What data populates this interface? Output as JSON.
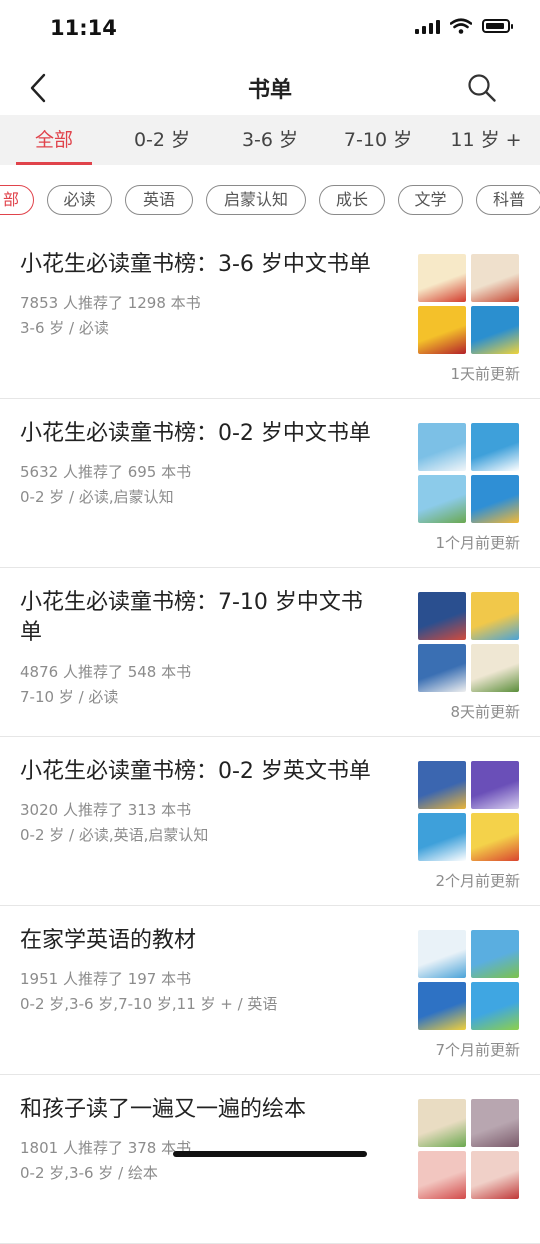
{
  "status_bar": {
    "time": "11:14",
    "icons": [
      "signal-icon",
      "wifi-icon",
      "battery-icon"
    ]
  },
  "header": {
    "title": "书单",
    "back_icon": "chevron-left-icon",
    "search_icon": "search-icon"
  },
  "age_tabs": [
    {
      "label": "全部",
      "active": true
    },
    {
      "label": "0-2 岁",
      "active": false
    },
    {
      "label": "3-6 岁",
      "active": false
    },
    {
      "label": "7-10 岁",
      "active": false
    },
    {
      "label": "11 岁 +",
      "active": false
    }
  ],
  "category_chips": [
    {
      "label": "部",
      "active": true
    },
    {
      "label": "必读",
      "active": false
    },
    {
      "label": "英语",
      "active": false
    },
    {
      "label": "启蒙认知",
      "active": false
    },
    {
      "label": "成长",
      "active": false
    },
    {
      "label": "文学",
      "active": false
    },
    {
      "label": "科普",
      "active": false
    }
  ],
  "colors": {
    "accent": "#e0434b",
    "muted_text": "#8c8c8c",
    "tab_bar_bg": "#f2f2f2"
  },
  "booklists": [
    {
      "title": "小花生必读童书榜：3-6 岁中文书单",
      "stats": "7853 人推荐了 1298 本书",
      "tags": "3-6 岁 / 必读",
      "updated": "1天前更新",
      "thumb_colors": [
        [
          "#f7e9c8",
          "#d23a2b"
        ],
        [
          "#efe0cc",
          "#c4432f"
        ],
        [
          "#f4c12a",
          "#b3202a"
        ],
        [
          "#2b8fcf",
          "#f0d43a"
        ]
      ]
    },
    {
      "title": "小花生必读童书榜：0-2 岁中文书单",
      "stats": "5632 人推荐了 695 本书",
      "tags": "0-2 岁 / 必读,启蒙认知",
      "updated": "1个月前更新",
      "thumb_colors": [
        [
          "#7cc0e6",
          "#f2f6f9"
        ],
        [
          "#3ea0da",
          "#ffffff"
        ],
        [
          "#8ccbea",
          "#6aa84f"
        ],
        [
          "#2f8fd5",
          "#f5b934"
        ]
      ]
    },
    {
      "title": "小花生必读童书榜：7-10 岁中文书单",
      "stats": "4876 人推荐了 548 本书",
      "tags": "7-10 岁 / 必读",
      "updated": "8天前更新",
      "thumb_colors": [
        [
          "#2a4f8f",
          "#d34b3c"
        ],
        [
          "#f1c84a",
          "#4aa3d8"
        ],
        [
          "#3a6fb3",
          "#f0f0f0"
        ],
        [
          "#efe7d3",
          "#5a8e3a"
        ]
      ]
    },
    {
      "title": "小花生必读童书榜：0-2 岁英文书单",
      "stats": "3020 人推荐了 313 本书",
      "tags": "0-2 岁 / 必读,英语,启蒙认知",
      "updated": "2个月前更新",
      "thumb_colors": [
        [
          "#3b66b0",
          "#e9b53a"
        ],
        [
          "#6a4fb8",
          "#d8d0f0"
        ],
        [
          "#3ea0da",
          "#ffffff"
        ],
        [
          "#f4d24a",
          "#d9442f"
        ]
      ]
    },
    {
      "title": "在家学英语的教材",
      "stats": "1951 人推荐了 197 本书",
      "tags": "0-2 岁,3-6 岁,7-10 岁,11 岁 + / 英语",
      "updated": "7个月前更新",
      "thumb_colors": [
        [
          "#e9f2f8",
          "#4aa3d8"
        ],
        [
          "#5aaee0",
          "#7cc24a"
        ],
        [
          "#2e72c4",
          "#f2d13a"
        ],
        [
          "#3fa6e2",
          "#8ed04a"
        ]
      ]
    },
    {
      "title": "和孩子读了一遍又一遍的绘本",
      "stats": "1801 人推荐了 378 本书",
      "tags": "0-2 岁,3-6 岁 / 绘本",
      "updated": "",
      "thumb_colors": [
        [
          "#e9dcc2",
          "#6aa84f"
        ],
        [
          "#b8a6b0",
          "#7a5a6a"
        ],
        [
          "#f2c6c0",
          "#d24a4a"
        ],
        [
          "#f0d0c8",
          "#c03838"
        ]
      ]
    }
  ]
}
